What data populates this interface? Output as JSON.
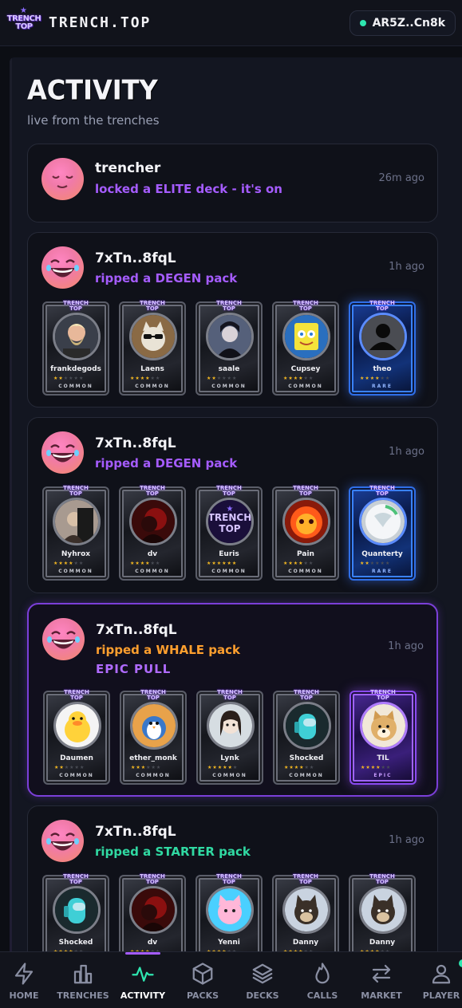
{
  "header": {
    "logo_text_line1": "TRENCH",
    "logo_text_line2": "TOP",
    "brand": "TRENCH.TOP",
    "wallet": "AR5Z..Cn8k"
  },
  "page": {
    "title": "ACTIVITY",
    "subtitle": "live from the trenches"
  },
  "feed": [
    {
      "user": "trencher",
      "action": "locked a ELITE deck - it's on",
      "action_color": "purple",
      "time": "26m ago",
      "avatar": "sleeping-face-icon",
      "cards": []
    },
    {
      "user": "7xTn..8fqL",
      "action": "ripped a DEGEN pack",
      "action_color": "purple",
      "time": "1h ago",
      "avatar": "laughing-face-icon",
      "cards": [
        {
          "name": "frankdegods",
          "stars": 2,
          "rarity": "COMMON",
          "portrait": "bearded-man"
        },
        {
          "name": "Laens",
          "stars": 4,
          "rarity": "COMMON",
          "portrait": "cat-sunglasses"
        },
        {
          "name": "saale",
          "stars": 2,
          "rarity": "COMMON",
          "portrait": "anime-dark"
        },
        {
          "name": "Cupsey",
          "stars": 4,
          "rarity": "COMMON",
          "portrait": "sponge"
        },
        {
          "name": "theo",
          "stars": 4,
          "rarity": "RARE",
          "portrait": "default-user"
        }
      ]
    },
    {
      "user": "7xTn..8fqL",
      "action": "ripped a DEGEN pack",
      "action_color": "purple",
      "time": "1h ago",
      "avatar": "laughing-face-icon",
      "cards": [
        {
          "name": "Nyhrox",
          "stars": 4,
          "rarity": "COMMON",
          "portrait": "photo-person"
        },
        {
          "name": "dv",
          "stars": 4,
          "rarity": "COMMON",
          "portrait": "red-dark"
        },
        {
          "name": "Euris",
          "stars": 6,
          "rarity": "COMMON",
          "portrait": "trench-logo"
        },
        {
          "name": "Pain",
          "stars": 4,
          "rarity": "COMMON",
          "portrait": "fire-face"
        },
        {
          "name": "Quanterty",
          "stars": 2,
          "rarity": "RARE",
          "portrait": "white-creature"
        }
      ]
    },
    {
      "user": "7xTn..8fqL",
      "action": "ripped a WHALE pack",
      "action_color": "orange",
      "extra": "EPIC PULL",
      "time": "1h ago",
      "avatar": "laughing-face-icon",
      "cards": [
        {
          "name": "Daumen",
          "stars": 2,
          "rarity": "COMMON",
          "portrait": "duck"
        },
        {
          "name": "ether_monk",
          "stars": 3,
          "rarity": "COMMON",
          "portrait": "penguin"
        },
        {
          "name": "Lynk",
          "stars": 5,
          "rarity": "COMMON",
          "portrait": "anime-girl"
        },
        {
          "name": "Shocked",
          "stars": 4,
          "rarity": "COMMON",
          "portrait": "among-us"
        },
        {
          "name": "TIL",
          "stars": 4,
          "rarity": "EPIC",
          "portrait": "doge"
        }
      ]
    },
    {
      "user": "7xTn..8fqL",
      "action": "ripped a STARTER pack",
      "action_color": "green",
      "time": "1h ago",
      "avatar": "laughing-face-icon",
      "cards": [
        {
          "name": "Shocked",
          "stars": 4,
          "rarity": "",
          "portrait": "among-us"
        },
        {
          "name": "dv",
          "stars": 4,
          "rarity": "",
          "portrait": "red-dark"
        },
        {
          "name": "Yenni",
          "stars": 4,
          "rarity": "",
          "portrait": "pink-cat"
        },
        {
          "name": "Danny",
          "stars": 4,
          "rarity": "",
          "portrait": "shiba"
        },
        {
          "name": "Danny",
          "stars": 4,
          "rarity": "",
          "portrait": "shiba"
        }
      ]
    }
  ],
  "nav": [
    {
      "label": "HOME",
      "icon": "lightning-icon"
    },
    {
      "label": "TRENCHES",
      "icon": "bar-chart-icon"
    },
    {
      "label": "ACTIVITY",
      "icon": "pulse-icon",
      "active": true
    },
    {
      "label": "PACKS",
      "icon": "box-icon"
    },
    {
      "label": "DECKS",
      "icon": "layers-icon"
    },
    {
      "label": "CALLS",
      "icon": "flame-icon"
    },
    {
      "label": "MARKET",
      "icon": "swap-icon"
    },
    {
      "label": "PLAYER",
      "icon": "user-icon",
      "notification": true
    }
  ],
  "colors": {
    "purple": "#a55cff",
    "orange": "#ff9f2e",
    "green": "#30d9a2",
    "accent_teal": "#2ee6b0"
  }
}
